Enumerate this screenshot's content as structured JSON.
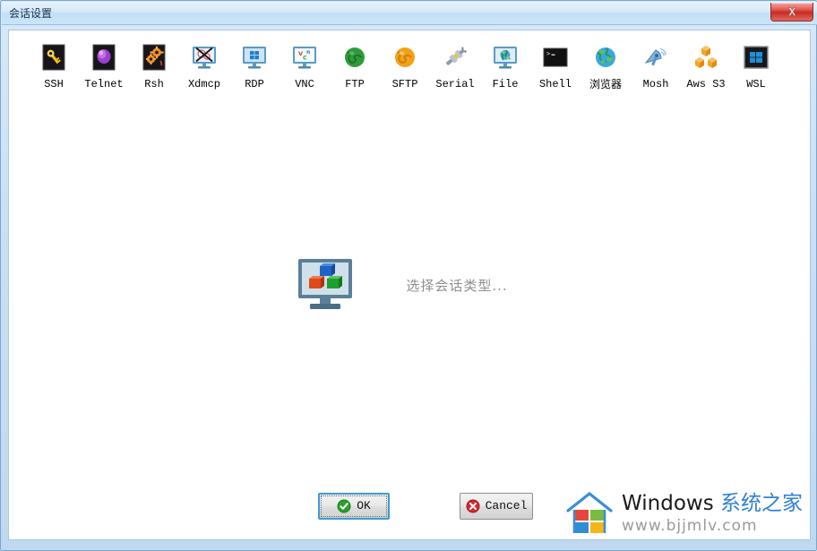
{
  "window": {
    "title": "会话设置",
    "close_button_label": "X",
    "close_icon": "close-x-icon"
  },
  "session_types": [
    {
      "label": "SSH",
      "icon": "ssh-key-icon",
      "cjk": false
    },
    {
      "label": "Telnet",
      "icon": "telnet-sphere-icon",
      "cjk": false
    },
    {
      "label": "Rsh",
      "icon": "rsh-gears-icon",
      "cjk": false
    },
    {
      "label": "Xdmcp",
      "icon": "xdmcp-monitor-icon",
      "cjk": false
    },
    {
      "label": "RDP",
      "icon": "rdp-monitor-icon",
      "cjk": false
    },
    {
      "label": "VNC",
      "icon": "vnc-monitor-icon",
      "cjk": false
    },
    {
      "label": "FTP",
      "icon": "ftp-green-globe-icon",
      "cjk": false
    },
    {
      "label": "SFTP",
      "icon": "sftp-orange-globe-icon",
      "cjk": false
    },
    {
      "label": "Serial",
      "icon": "serial-plug-icon",
      "cjk": false
    },
    {
      "label": "File",
      "icon": "file-monitor-globe-icon",
      "cjk": false
    },
    {
      "label": "Shell",
      "icon": "shell-terminal-icon",
      "cjk": false
    },
    {
      "label": "浏览器",
      "icon": "browser-globe-icon",
      "cjk": true
    },
    {
      "label": "Mosh",
      "icon": "mosh-satellite-icon",
      "cjk": false
    },
    {
      "label": "Aws S3",
      "icon": "aws-s3-cubes-icon",
      "cjk": false
    },
    {
      "label": "WSL",
      "icon": "wsl-windows-icon",
      "cjk": false
    }
  ],
  "placeholder": {
    "icon": "monitor-cubes-icon",
    "text": "选择会话类型..."
  },
  "buttons": {
    "ok": {
      "label": "OK",
      "icon": "green-check-icon",
      "focused": true
    },
    "cancel": {
      "label": "Cancel",
      "icon": "red-x-icon",
      "focused": false
    }
  },
  "watermark": {
    "logo_icon": "windows-house-logo-icon",
    "brand": "Windows ",
    "brand_suffix": "系统之家",
    "url": "www.bjjmlv.com"
  },
  "colors": {
    "titlebar_top": "#e8f3fc",
    "titlebar_bottom": "#cbe4f7",
    "window_border": "#7ba5c9",
    "close_red": "#c92b24",
    "focus_blue": "#3c99d4",
    "placeholder_text": "#8e8e8e",
    "watermark_blue": "#2f7fd4"
  }
}
